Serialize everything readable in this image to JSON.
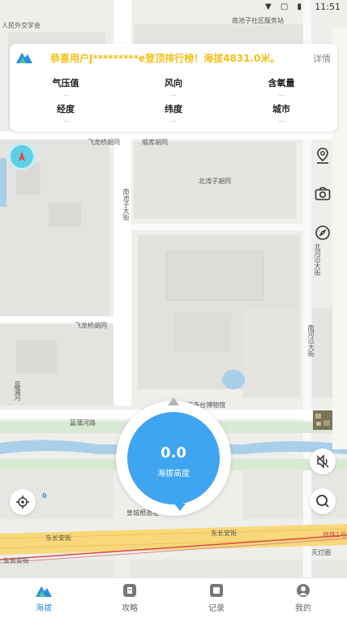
{
  "status_bar": {
    "time": "11:51"
  },
  "card": {
    "marquee": "恭喜用户J*********e登顶排行榜！海拔4831.0米。",
    "detail_label": "详情",
    "cells": [
      {
        "label": "气压值",
        "value": "--"
      },
      {
        "label": "风向",
        "value": "--"
      },
      {
        "label": "含氧量",
        "value": "--"
      },
      {
        "label": "经度",
        "value": "--"
      },
      {
        "label": "纬度",
        "value": "--"
      },
      {
        "label": "城市",
        "value": "--"
      }
    ]
  },
  "dial": {
    "value": "0.0",
    "label": "海拔高度"
  },
  "map_labels": {
    "l1": "人民外交学会",
    "l2": "南池子社区服务站",
    "l3": "飞龙桥胡同",
    "l4": "缎库胡同",
    "l5": "北湾子胡同",
    "l6": "南池子大街",
    "l7": "飞龙桥胡同",
    "l8": "菖蒲河路",
    "l9": "普渡寺台博物馆",
    "l10": "菖蒲河",
    "l11": "东长安街",
    "l12": "东长安街",
    "l13": "东长安街",
    "l14": "皇城根遗址",
    "l15": "灭灯圈",
    "l16": "南河沿大街",
    "l17": "北河沿大街",
    "l18": "地铁1号线",
    "l19": "0"
  },
  "nav": [
    {
      "label": "海拔",
      "icon": "mountain-icon",
      "active": true
    },
    {
      "label": "攻略",
      "icon": "guide-icon",
      "active": false
    },
    {
      "label": "记录",
      "icon": "record-icon",
      "active": false
    },
    {
      "label": "我的",
      "icon": "profile-icon",
      "active": false
    }
  ],
  "colors": {
    "accent": "#3fa5f0",
    "marquee": "#f2c21a",
    "compass": "#5ecfe8"
  }
}
